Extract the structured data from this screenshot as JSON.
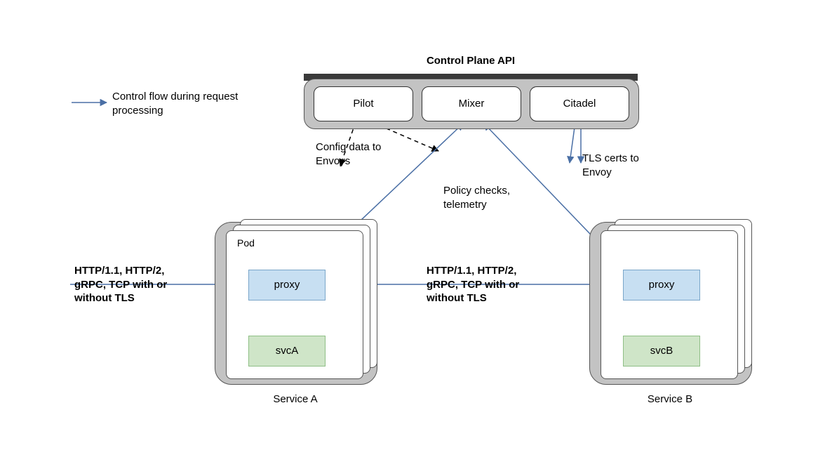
{
  "control_plane": {
    "title": "Control Plane API",
    "pilot": "Pilot",
    "mixer": "Mixer",
    "citadel": "Citadel"
  },
  "legend": {
    "arrow_label": "Control flow during request processing"
  },
  "annotations": {
    "config_to_envoys": "Config data to Envoys",
    "policy_checks": "Policy checks, telemetry",
    "tls_certs": "TLS certs to Envoy"
  },
  "pod": {
    "label": "Pod",
    "proxy_label": "proxy"
  },
  "services": {
    "a": {
      "label": "svcA",
      "title": "Service A"
    },
    "b": {
      "label": "svcB",
      "title": "Service B"
    }
  },
  "protocols": "HTTP/1.1, HTTP/2, gRPC, TCP with or without TLS"
}
